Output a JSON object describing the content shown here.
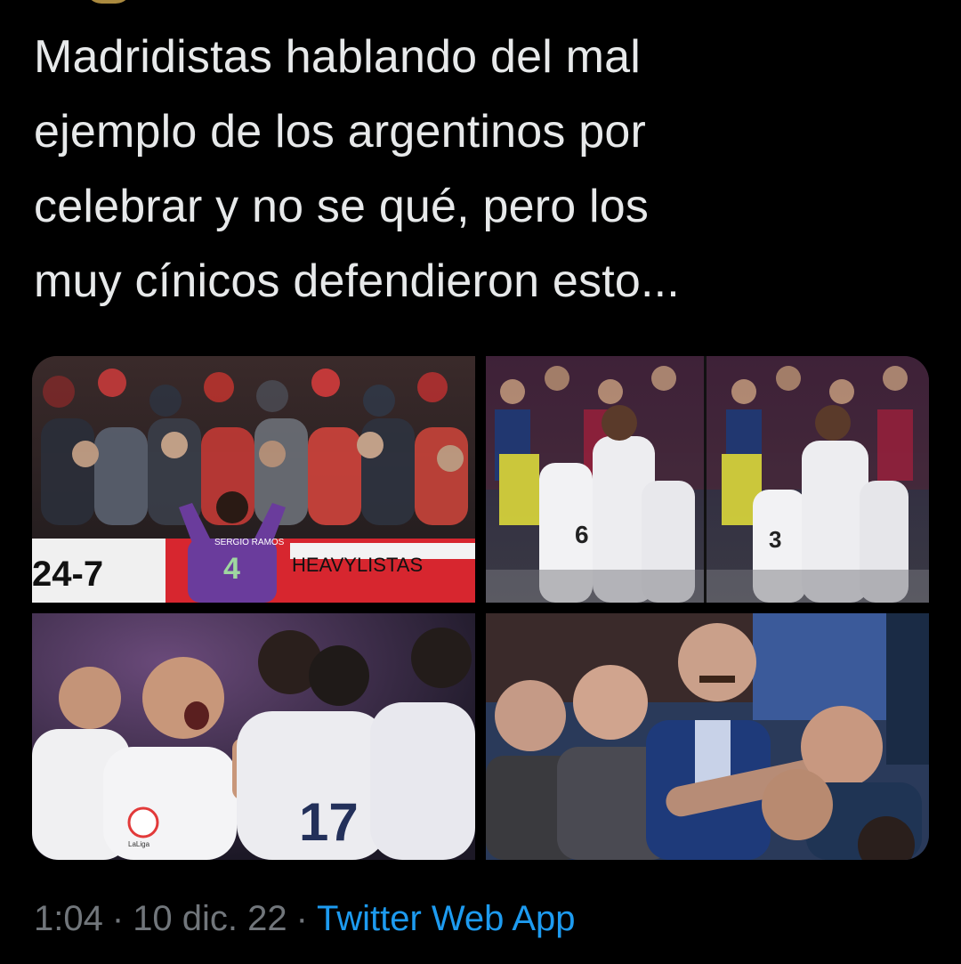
{
  "tweet": {
    "text": "Madridistas hablando del mal\nejemplo de los argentinos por\ncelebrar y no se qué, pero los\nmuy cínicos defendieron esto..."
  },
  "media": {
    "tile1": {
      "jersey_name": "SERGIO RAMOS",
      "jersey_number": "4",
      "banner_left": "24-7",
      "banner_right": "HEAVYLISTAS"
    },
    "tile2": {
      "jersey_number_left": "6",
      "jersey_number_right": "3"
    },
    "tile3": {
      "jersey_number": "17",
      "badge_text": "LaLiga"
    },
    "tile4": {}
  },
  "meta": {
    "time": "1:04",
    "date": "10 dic. 22",
    "separator": "·",
    "source": "Twitter Web App",
    "source_color": "#1d9bf0",
    "muted_color": "#71767b"
  }
}
